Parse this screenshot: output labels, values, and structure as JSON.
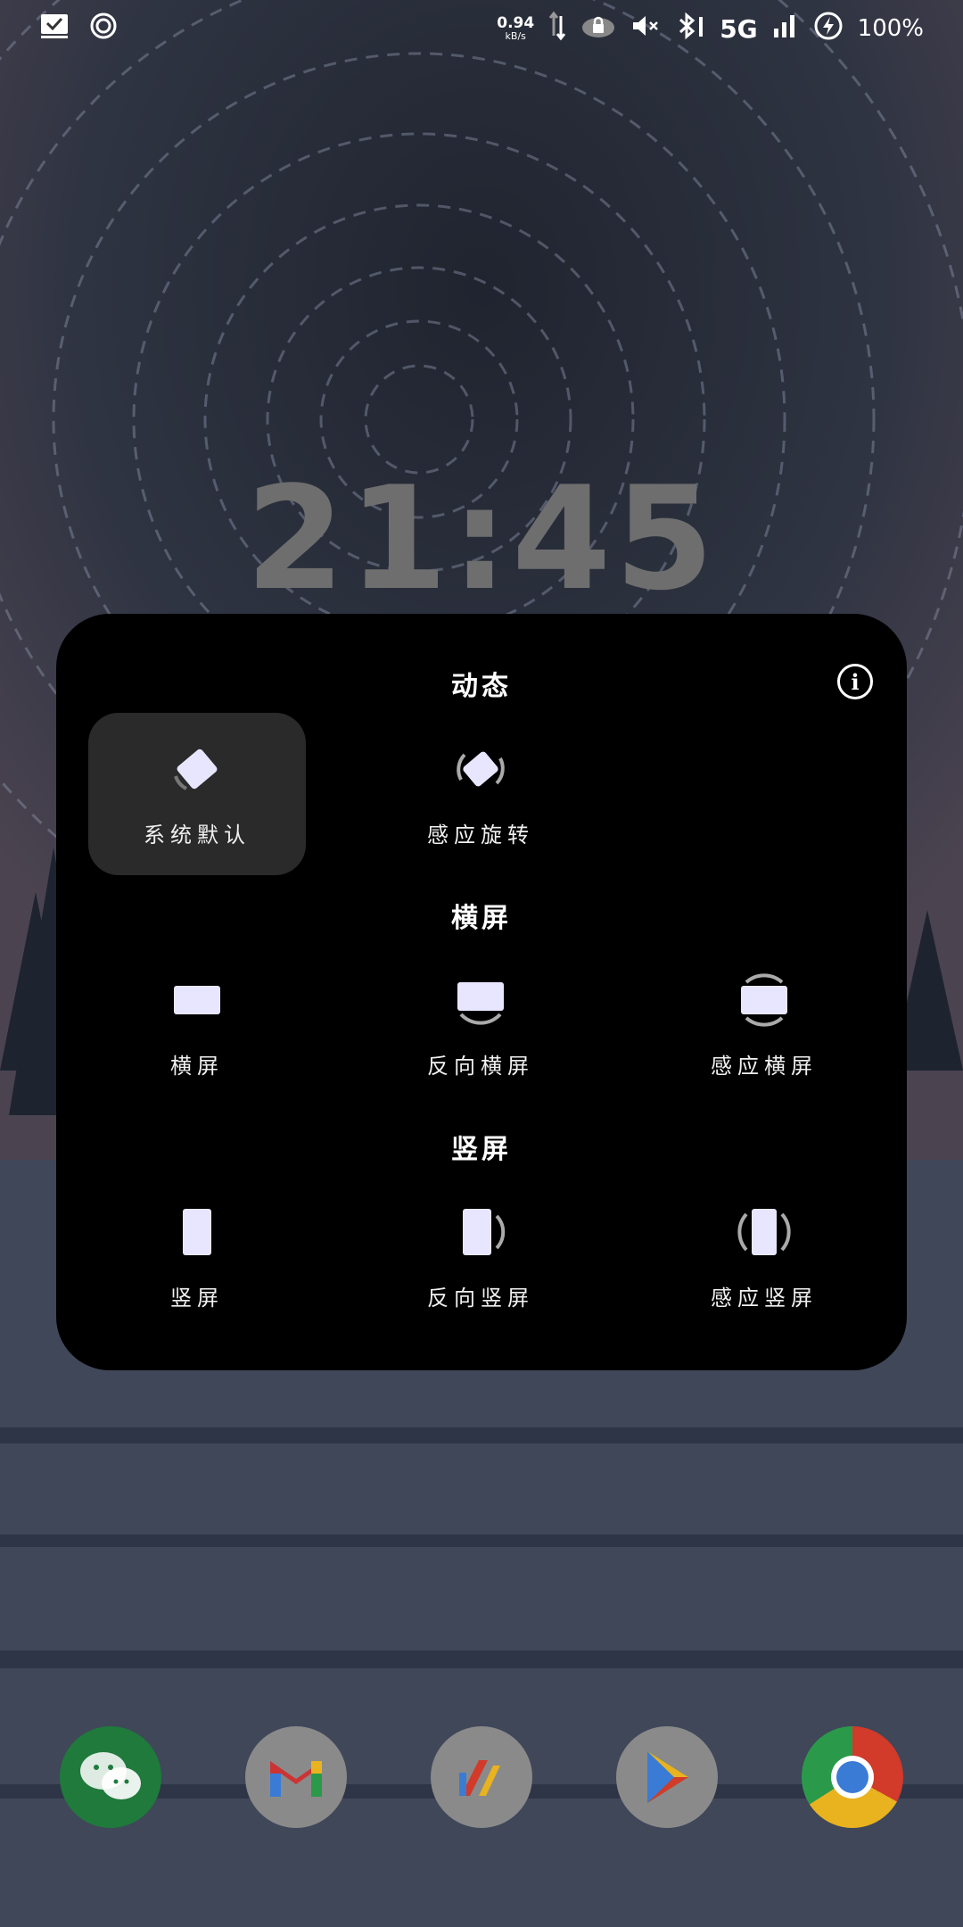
{
  "status_bar": {
    "net_speed_value": "0.94",
    "net_speed_unit": "kB/s",
    "network": "5G",
    "battery": "100%"
  },
  "clock": {
    "time": "21:45"
  },
  "panel": {
    "dynamic_title": "动态",
    "landscape_title": "横屏",
    "portrait_title": "竖屏",
    "options": {
      "system_default": "系统默认",
      "auto_rotate": "感应旋转",
      "landscape": "横屏",
      "reverse_landscape": "反向横屏",
      "sensor_landscape": "感应横屏",
      "portrait": "竖屏",
      "reverse_portrait": "反向竖屏",
      "sensor_portrait": "感应竖屏"
    },
    "selected": "system_default"
  },
  "dock": {
    "apps": [
      "wechat-icon",
      "gmail-icon",
      "app-icon",
      "play-store-icon",
      "chrome-icon"
    ]
  },
  "colors": {
    "panel_bg": "#000000",
    "selected_bg": "#2a2a2a",
    "icon_fill": "#e8e6ff",
    "clock": "#6e6e6e"
  }
}
